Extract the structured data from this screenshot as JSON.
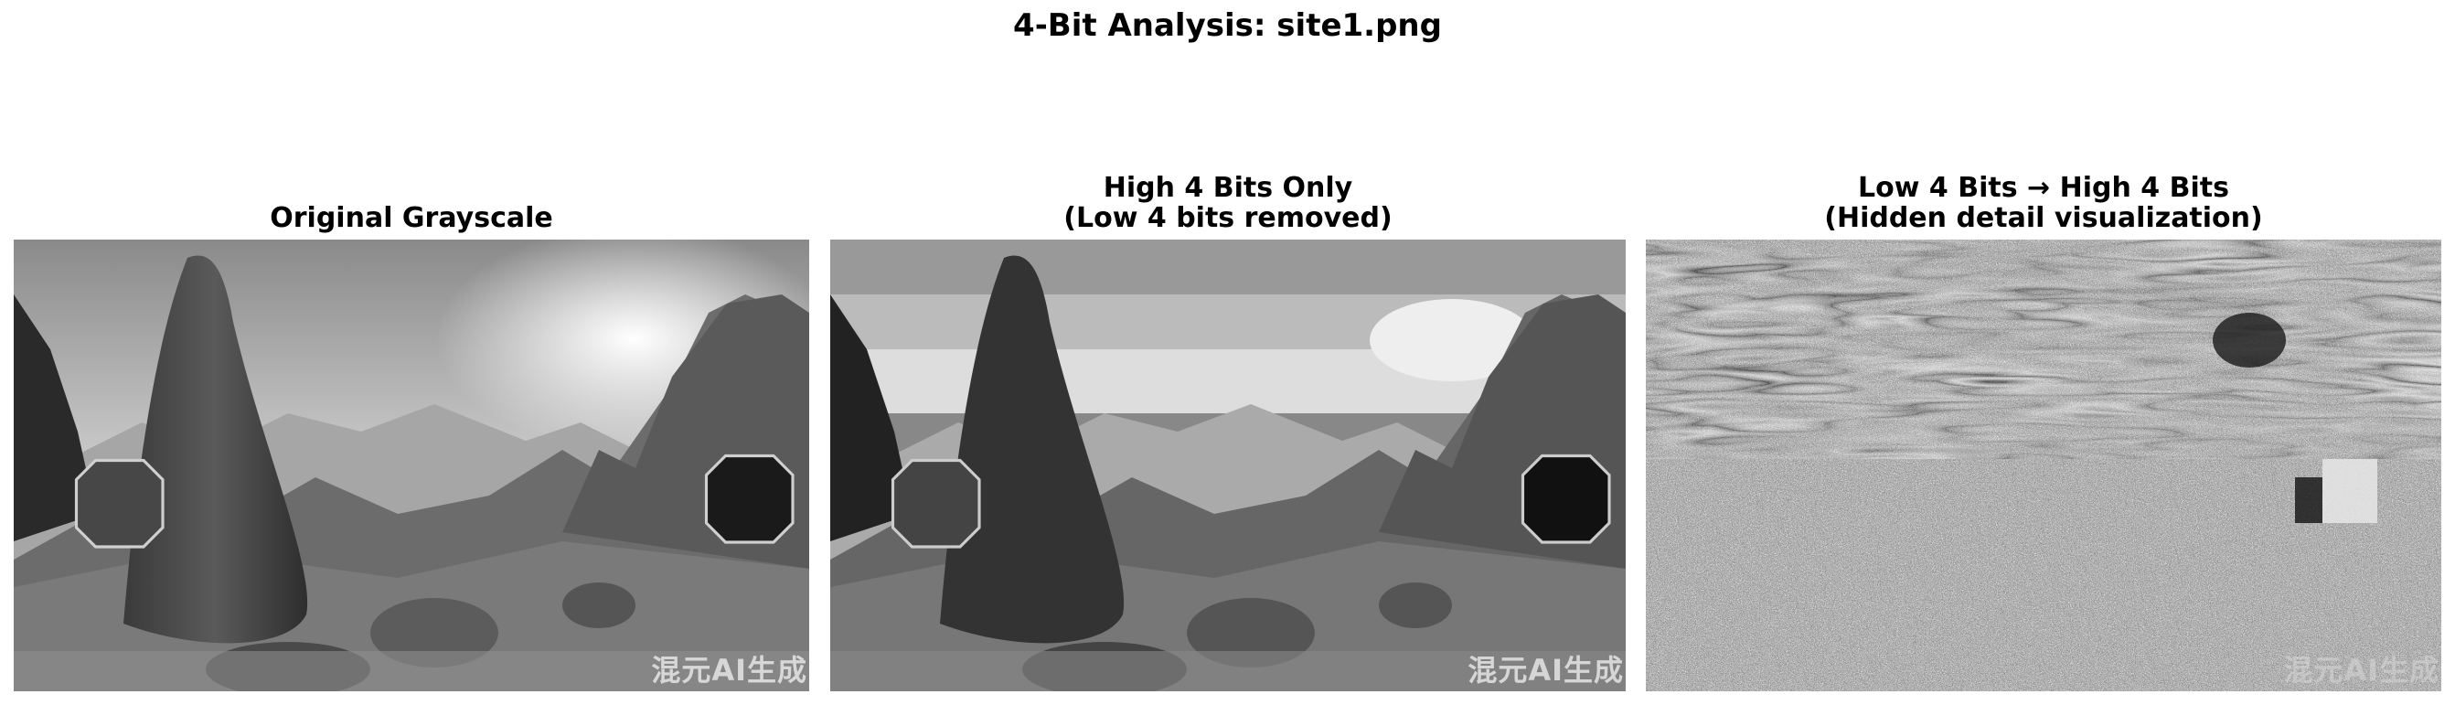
{
  "figure": {
    "title": "4-Bit Analysis: site1.png"
  },
  "panels": [
    {
      "title_line1": "",
      "title_line2": "Original Grayscale",
      "watermark": "混元AI生成"
    },
    {
      "title_line1": "High 4 Bits Only",
      "title_line2": "(Low 4 bits removed)",
      "watermark": "混元AI生成"
    },
    {
      "title_line1": "Low 4 Bits → High 4 Bits",
      "title_line2": "(Hidden detail visualization)",
      "watermark": "混元AI生成"
    }
  ],
  "colors": {
    "background": "#ffffff",
    "text": "#000000"
  }
}
